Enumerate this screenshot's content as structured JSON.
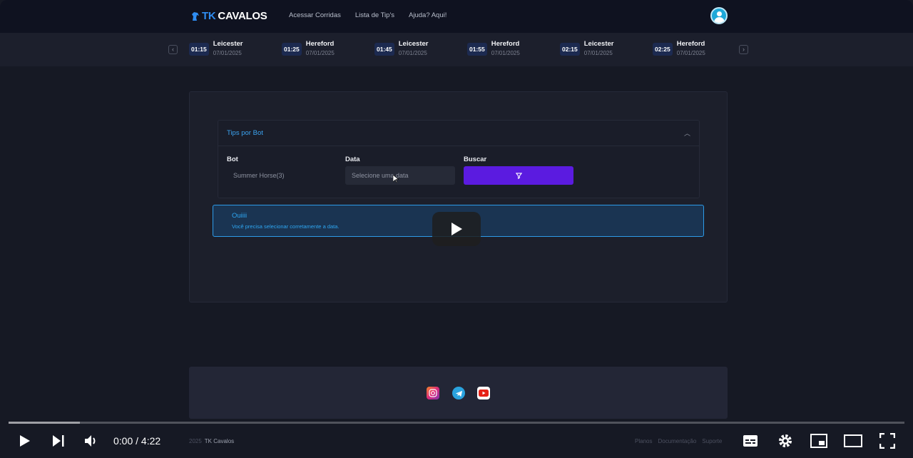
{
  "nav": {
    "logo_prefix": "TK",
    "logo_name": "CAVALOS",
    "links": [
      "Acessar Corridas",
      "Lista de Tip's",
      "Ajuda? Aqui!"
    ]
  },
  "races": [
    {
      "time": "01:15",
      "name": "Leicester",
      "date": "07/01/2025"
    },
    {
      "time": "01:25",
      "name": "Hereford",
      "date": "07/01/2025"
    },
    {
      "time": "01:45",
      "name": "Leicester",
      "date": "07/01/2025"
    },
    {
      "time": "01:55",
      "name": "Hereford",
      "date": "07/01/2025"
    },
    {
      "time": "02:15",
      "name": "Leicester",
      "date": "07/01/2025"
    },
    {
      "time": "02:25",
      "name": "Hereford",
      "date": "07/01/2025"
    }
  ],
  "panel": {
    "title": "Tips por Bot",
    "bot_label": "Bot",
    "bot_value": "Summer Horse(3)",
    "date_label": "Data",
    "date_placeholder": "Selecione uma data",
    "search_label": "Buscar"
  },
  "alert": {
    "title": "Ouiiii",
    "text": "Você precisa selecionar corretamente a data."
  },
  "footer": {
    "year": "2025",
    "brand": "TK Cavalos",
    "links": [
      "Planos",
      "Documentação",
      "Suporte"
    ]
  },
  "player": {
    "time_display": "0:00 / 4:22",
    "buffered_fraction": 0.08
  },
  "colors": {
    "accent_blue": "#2f8df2",
    "search_purple": "#5b1be0",
    "alert_blue": "#2ea6f2"
  }
}
